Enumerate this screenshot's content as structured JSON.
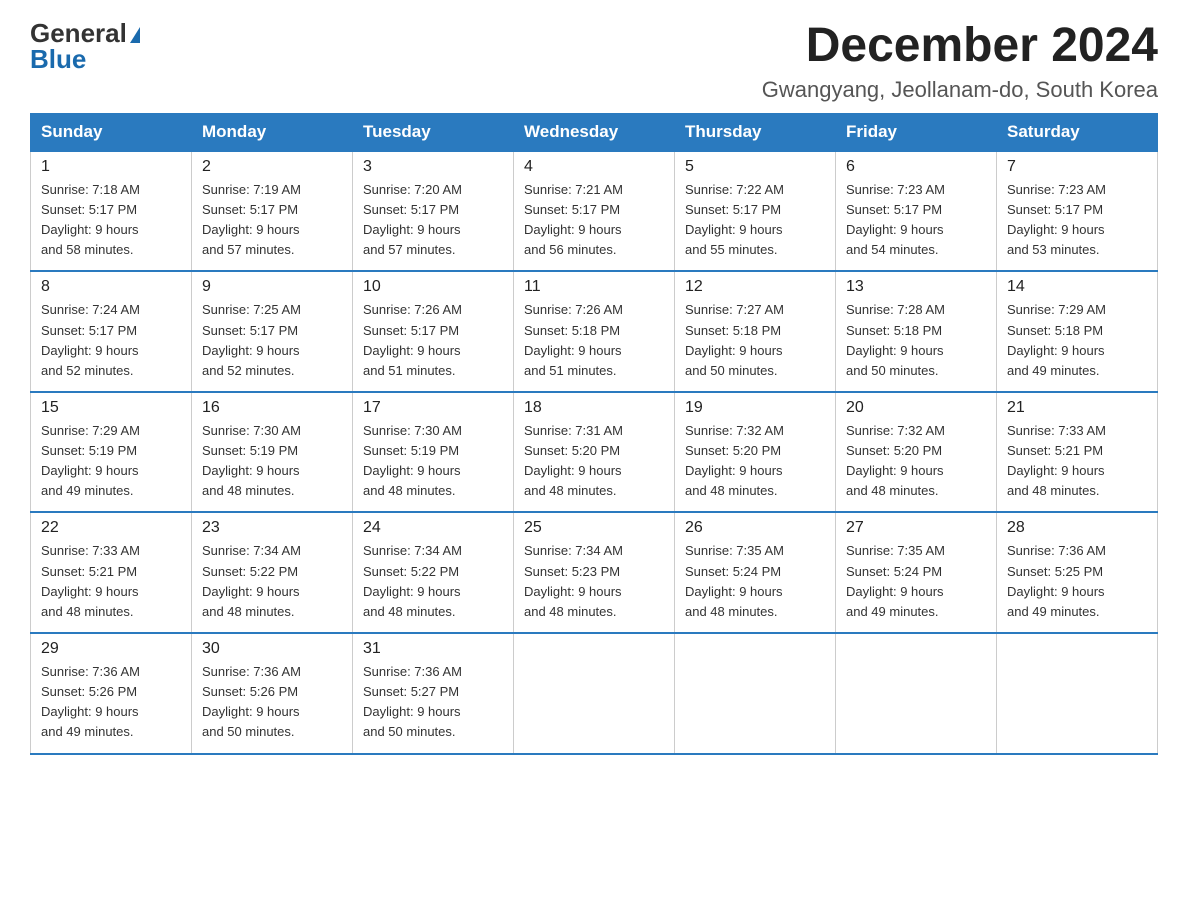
{
  "logo": {
    "general": "General",
    "blue": "Blue"
  },
  "title": {
    "month": "December 2024",
    "location": "Gwangyang, Jeollanam-do, South Korea"
  },
  "days_of_week": [
    "Sunday",
    "Monday",
    "Tuesday",
    "Wednesday",
    "Thursday",
    "Friday",
    "Saturday"
  ],
  "weeks": [
    [
      {
        "day": "1",
        "sunrise": "7:18 AM",
        "sunset": "5:17 PM",
        "daylight": "9 hours and 58 minutes."
      },
      {
        "day": "2",
        "sunrise": "7:19 AM",
        "sunset": "5:17 PM",
        "daylight": "9 hours and 57 minutes."
      },
      {
        "day": "3",
        "sunrise": "7:20 AM",
        "sunset": "5:17 PM",
        "daylight": "9 hours and 57 minutes."
      },
      {
        "day": "4",
        "sunrise": "7:21 AM",
        "sunset": "5:17 PM",
        "daylight": "9 hours and 56 minutes."
      },
      {
        "day": "5",
        "sunrise": "7:22 AM",
        "sunset": "5:17 PM",
        "daylight": "9 hours and 55 minutes."
      },
      {
        "day": "6",
        "sunrise": "7:23 AM",
        "sunset": "5:17 PM",
        "daylight": "9 hours and 54 minutes."
      },
      {
        "day": "7",
        "sunrise": "7:23 AM",
        "sunset": "5:17 PM",
        "daylight": "9 hours and 53 minutes."
      }
    ],
    [
      {
        "day": "8",
        "sunrise": "7:24 AM",
        "sunset": "5:17 PM",
        "daylight": "9 hours and 52 minutes."
      },
      {
        "day": "9",
        "sunrise": "7:25 AM",
        "sunset": "5:17 PM",
        "daylight": "9 hours and 52 minutes."
      },
      {
        "day": "10",
        "sunrise": "7:26 AM",
        "sunset": "5:17 PM",
        "daylight": "9 hours and 51 minutes."
      },
      {
        "day": "11",
        "sunrise": "7:26 AM",
        "sunset": "5:18 PM",
        "daylight": "9 hours and 51 minutes."
      },
      {
        "day": "12",
        "sunrise": "7:27 AM",
        "sunset": "5:18 PM",
        "daylight": "9 hours and 50 minutes."
      },
      {
        "day": "13",
        "sunrise": "7:28 AM",
        "sunset": "5:18 PM",
        "daylight": "9 hours and 50 minutes."
      },
      {
        "day": "14",
        "sunrise": "7:29 AM",
        "sunset": "5:18 PM",
        "daylight": "9 hours and 49 minutes."
      }
    ],
    [
      {
        "day": "15",
        "sunrise": "7:29 AM",
        "sunset": "5:19 PM",
        "daylight": "9 hours and 49 minutes."
      },
      {
        "day": "16",
        "sunrise": "7:30 AM",
        "sunset": "5:19 PM",
        "daylight": "9 hours and 48 minutes."
      },
      {
        "day": "17",
        "sunrise": "7:30 AM",
        "sunset": "5:19 PM",
        "daylight": "9 hours and 48 minutes."
      },
      {
        "day": "18",
        "sunrise": "7:31 AM",
        "sunset": "5:20 PM",
        "daylight": "9 hours and 48 minutes."
      },
      {
        "day": "19",
        "sunrise": "7:32 AM",
        "sunset": "5:20 PM",
        "daylight": "9 hours and 48 minutes."
      },
      {
        "day": "20",
        "sunrise": "7:32 AM",
        "sunset": "5:20 PM",
        "daylight": "9 hours and 48 minutes."
      },
      {
        "day": "21",
        "sunrise": "7:33 AM",
        "sunset": "5:21 PM",
        "daylight": "9 hours and 48 minutes."
      }
    ],
    [
      {
        "day": "22",
        "sunrise": "7:33 AM",
        "sunset": "5:21 PM",
        "daylight": "9 hours and 48 minutes."
      },
      {
        "day": "23",
        "sunrise": "7:34 AM",
        "sunset": "5:22 PM",
        "daylight": "9 hours and 48 minutes."
      },
      {
        "day": "24",
        "sunrise": "7:34 AM",
        "sunset": "5:22 PM",
        "daylight": "9 hours and 48 minutes."
      },
      {
        "day": "25",
        "sunrise": "7:34 AM",
        "sunset": "5:23 PM",
        "daylight": "9 hours and 48 minutes."
      },
      {
        "day": "26",
        "sunrise": "7:35 AM",
        "sunset": "5:24 PM",
        "daylight": "9 hours and 48 minutes."
      },
      {
        "day": "27",
        "sunrise": "7:35 AM",
        "sunset": "5:24 PM",
        "daylight": "9 hours and 49 minutes."
      },
      {
        "day": "28",
        "sunrise": "7:36 AM",
        "sunset": "5:25 PM",
        "daylight": "9 hours and 49 minutes."
      }
    ],
    [
      {
        "day": "29",
        "sunrise": "7:36 AM",
        "sunset": "5:26 PM",
        "daylight": "9 hours and 49 minutes."
      },
      {
        "day": "30",
        "sunrise": "7:36 AM",
        "sunset": "5:26 PM",
        "daylight": "9 hours and 50 minutes."
      },
      {
        "day": "31",
        "sunrise": "7:36 AM",
        "sunset": "5:27 PM",
        "daylight": "9 hours and 50 minutes."
      },
      null,
      null,
      null,
      null
    ]
  ],
  "labels": {
    "sunrise": "Sunrise:",
    "sunset": "Sunset:",
    "daylight": "Daylight:"
  }
}
